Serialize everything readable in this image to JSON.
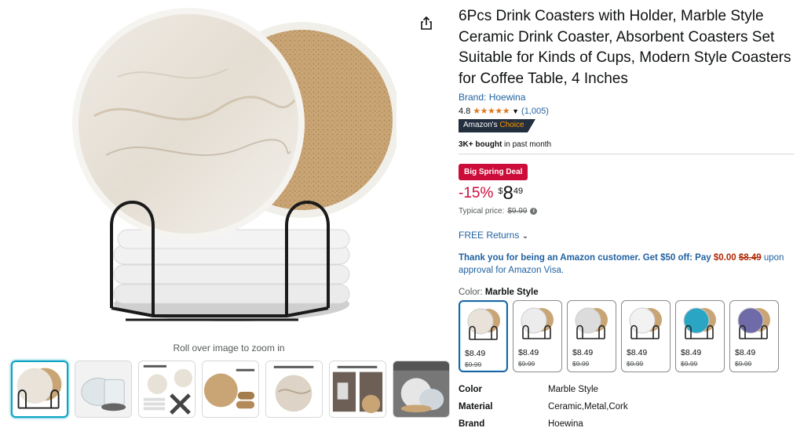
{
  "product": {
    "title": "6Pcs Drink Coasters with Holder, Marble Style Ceramic Drink Coaster, Absorbent Coasters Set Suitable for Kinds of Cups, Modern Style Coasters for Coffee Table, 4 Inches",
    "brand": "Brand: Hoewina",
    "rating": "4.8",
    "stars": "★★★★★",
    "rating_count": "(1,005)",
    "badge_left": "Amazon's",
    "badge_right": "Choice",
    "bought_bold": "3K+ bought",
    "bought_rest": " in past month"
  },
  "pricing": {
    "deal_label": "Big Spring Deal",
    "discount": "-15%",
    "currency": "$",
    "whole": "8",
    "fraction": "49",
    "typical_label": "Typical price: ",
    "typical_price": "$9.99",
    "returns": "FREE Returns"
  },
  "promo": {
    "bold": "Thank you for being an Amazon customer. Get $50 off: Pay",
    "pay": "$0.00",
    "strike": "$8.49",
    "rest": "upon approval for Amazon Visa."
  },
  "color": {
    "label": "Color: ",
    "selected": "Marble Style",
    "options": [
      {
        "price": "$8.49",
        "orig": "$9.99",
        "face": "#e8e2d8"
      },
      {
        "price": "$8.49",
        "orig": "$9.99",
        "face": "#ececec"
      },
      {
        "price": "$8.49",
        "orig": "$9.99",
        "face": "#dcdcdc"
      },
      {
        "price": "$8.49",
        "orig": "$9.99",
        "face": "#f2f2f2"
      },
      {
        "price": "$8.49",
        "orig": "$9.99",
        "face": "#2aa6c4"
      },
      {
        "price": "$8.49",
        "orig": "$9.99",
        "face": "#6f6aa8"
      }
    ]
  },
  "specs": [
    {
      "key": "Color",
      "value": "Marble Style"
    },
    {
      "key": "Material",
      "value": "Ceramic,Metal,Cork"
    },
    {
      "key": "Brand",
      "value": "Hoewina"
    }
  ],
  "gallery": {
    "zoom_hint": "Roll over image to zoom in"
  },
  "colors": {
    "link": "#2162a1",
    "deal_red": "#cc0c39",
    "star": "#de7921",
    "selected_thumb": "#0da4c4"
  }
}
